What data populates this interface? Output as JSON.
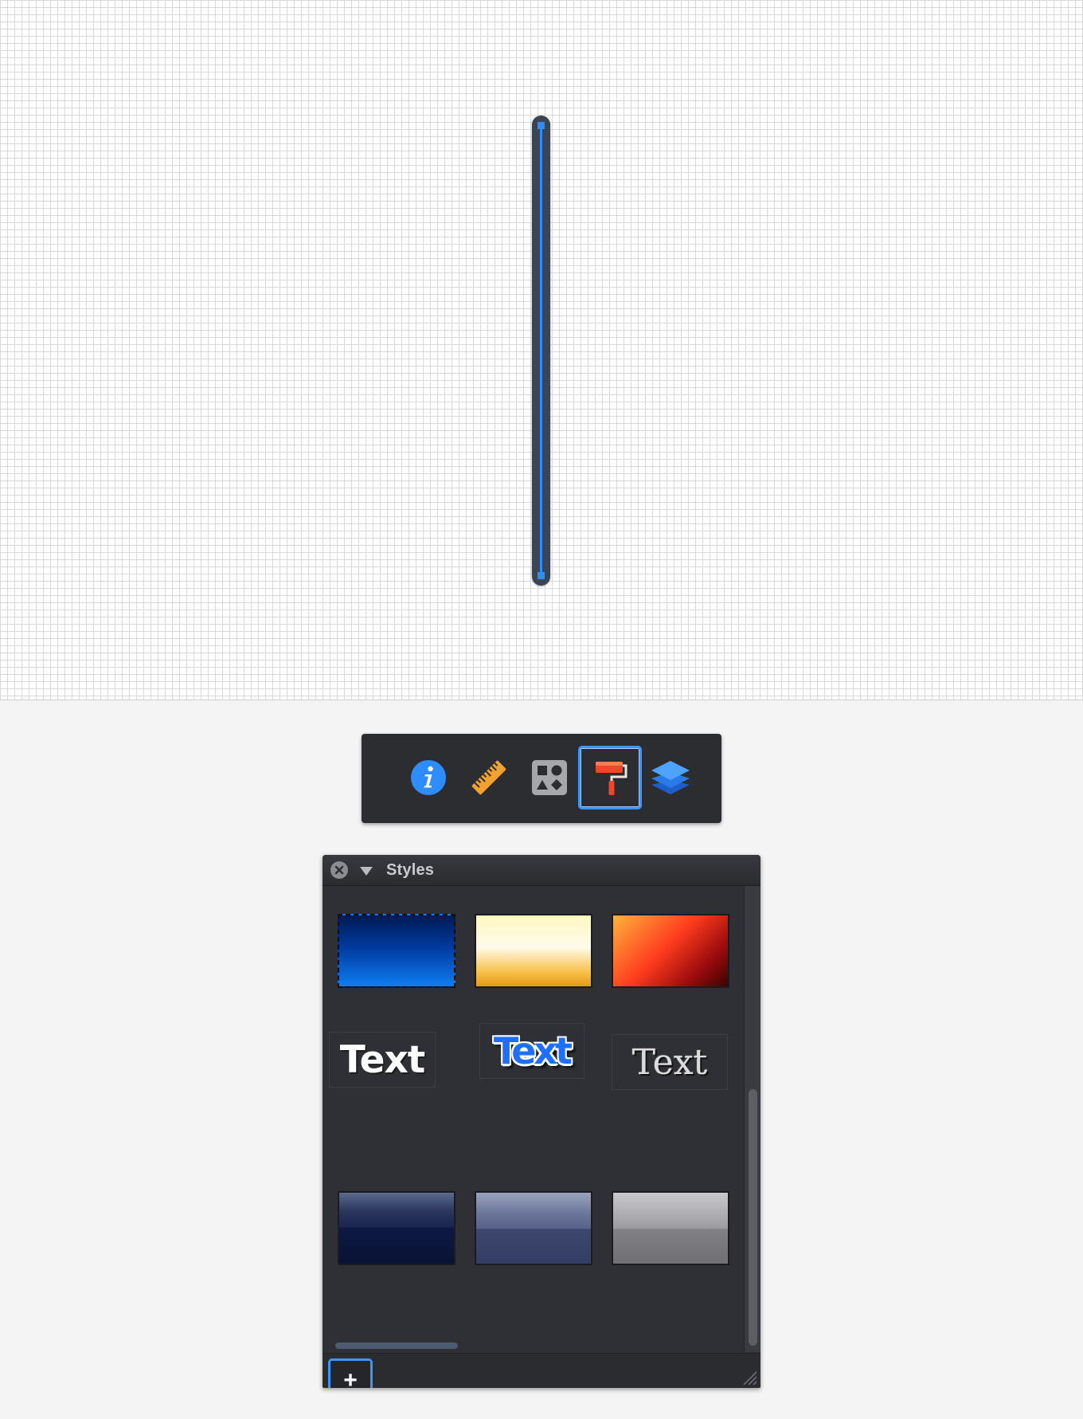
{
  "canvas": {
    "selected_shape": "line"
  },
  "toolbar": {
    "items": [
      {
        "name": "info",
        "icon": "info-icon",
        "active": false
      },
      {
        "name": "metrics",
        "icon": "ruler-icon",
        "active": false
      },
      {
        "name": "shapes",
        "icon": "shapes-icon",
        "active": false
      },
      {
        "name": "styles",
        "icon": "paint-roller-icon",
        "active": true
      },
      {
        "name": "layers",
        "icon": "layers-icon",
        "active": false
      }
    ]
  },
  "styles_panel": {
    "title": "Styles",
    "text_styles": [
      {
        "label": "Text"
      },
      {
        "label": "Text"
      },
      {
        "label": "Text"
      }
    ],
    "add_label": "+"
  },
  "colors": {
    "accent": "#3e95ff",
    "panel_bg": "#2f3035",
    "line_stroke": "#3b4453",
    "line_path": "#2f8cff"
  }
}
